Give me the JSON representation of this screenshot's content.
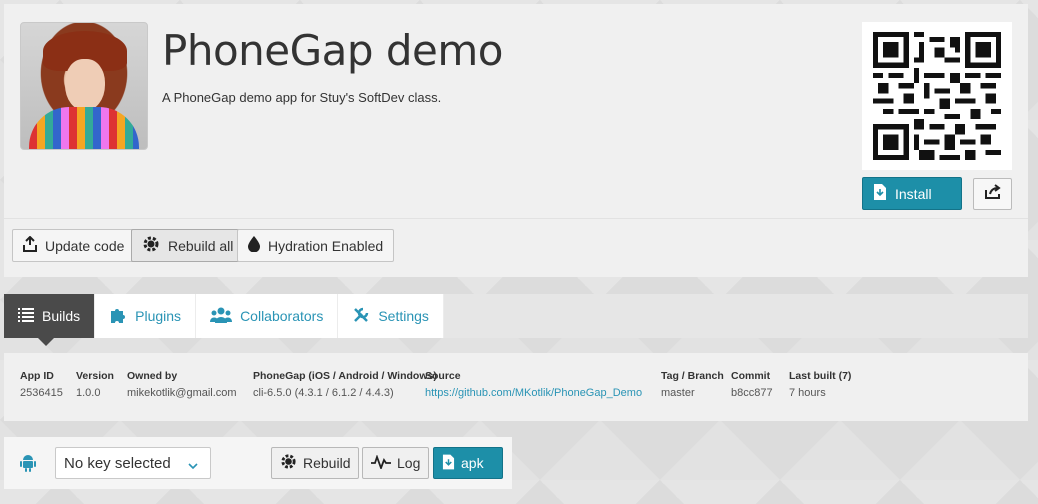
{
  "app": {
    "title": "PhoneGap demo",
    "description": "A PhoneGap demo app for Stuy's SoftDev class."
  },
  "header": {
    "install_label": "Install"
  },
  "actions": {
    "update_code": "Update code",
    "rebuild_all": "Rebuild all",
    "hydration": "Hydration Enabled"
  },
  "tabs": [
    {
      "label": "Builds",
      "icon": "list-icon",
      "active": true
    },
    {
      "label": "Plugins",
      "icon": "puzzle-icon",
      "active": false
    },
    {
      "label": "Collaborators",
      "icon": "people-icon",
      "active": false
    },
    {
      "label": "Settings",
      "icon": "wrench-icon",
      "active": false
    }
  ],
  "info": {
    "app_id": {
      "header": "App ID",
      "value": "2536415"
    },
    "version": {
      "header": "Version",
      "value": "1.0.0"
    },
    "owner": {
      "header": "Owned by",
      "value": "mikekotlik@gmail.com"
    },
    "phonegap": {
      "header": "PhoneGap (iOS / Android / Windows)",
      "value": "cli-6.5.0 (4.3.1 / 6.1.2 / 4.4.3)"
    },
    "source": {
      "header": "Source",
      "value": "https://github.com/MKotlik/PhoneGap_Demo"
    },
    "tag": {
      "header": "Tag / Branch",
      "value": "master"
    },
    "commit": {
      "header": "Commit",
      "value": "b8cc877"
    },
    "last_built": {
      "header": "Last built (7)",
      "value": "7 hours"
    }
  },
  "platform": {
    "key_select": "No key selected",
    "rebuild": "Rebuild",
    "log": "Log",
    "download": "apk"
  },
  "colors": {
    "accent": "#1d8fa8",
    "link": "#2a94b5",
    "android": "#2a94b5"
  }
}
